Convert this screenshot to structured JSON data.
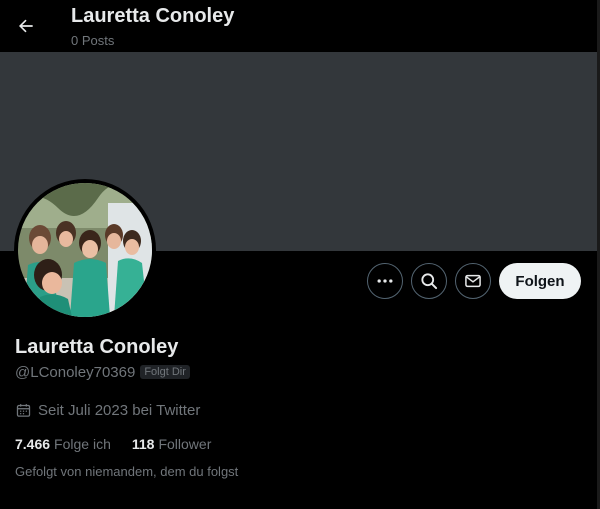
{
  "header": {
    "title": "Lauretta Conoley",
    "subtitle": "0 Posts",
    "back_icon": "arrow-left-icon"
  },
  "colors": {
    "banner": "#33373b",
    "background": "#000000",
    "muted_text": "#71767b",
    "follow_button_bg": "#eff3f4"
  },
  "profile": {
    "name": "Lauretta Conoley",
    "handle": "@LConoley70369",
    "follows_you_badge": "Folgt Dir",
    "joined": "Seit Juli 2023 bei Twitter",
    "following_count": "7.466",
    "following_label": "Folge ich",
    "followers_count": "118",
    "followers_label": "Follower",
    "followers_you_know": "Gefolgt von niemandem, dem du folgst"
  },
  "actions": {
    "more_icon": "more-icon",
    "search_icon": "search-icon",
    "message_icon": "mail-icon",
    "follow_label": "Folgen"
  }
}
